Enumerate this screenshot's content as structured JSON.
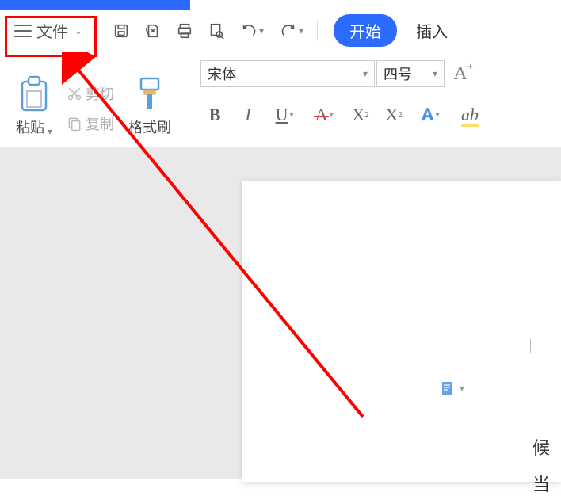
{
  "menu": {
    "file": "文件"
  },
  "tabs": {
    "start": "开始",
    "insert": "插入"
  },
  "clipboard": {
    "paste": "粘贴",
    "cut": "剪切",
    "copy": "复制",
    "formatPainter": "格式刷"
  },
  "font": {
    "name": "宋体",
    "size": "四号"
  },
  "page": {
    "text1": "候",
    "text2": "当"
  }
}
